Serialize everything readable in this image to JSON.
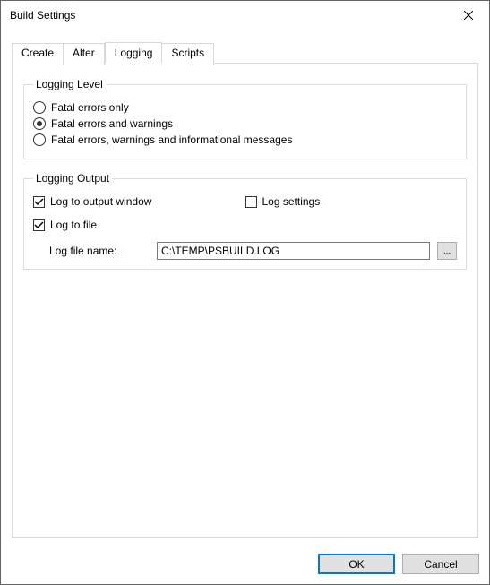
{
  "window": {
    "title": "Build Settings"
  },
  "tabs": {
    "create": "Create",
    "alter": "Alter",
    "logging": "Logging",
    "scripts": "Scripts"
  },
  "logging_level": {
    "legend": "Logging Level",
    "opt1": "Fatal errors only",
    "opt2": "Fatal errors and warnings",
    "opt3": "Fatal errors, warnings and informational messages"
  },
  "logging_output": {
    "legend": "Logging Output",
    "log_to_output": "Log to output window",
    "log_settings": "Log settings",
    "log_to_file": "Log to file",
    "log_file_label": "Log file name:",
    "log_file_value": "C:\\TEMP\\PSBUILD.LOG",
    "browse": "..."
  },
  "buttons": {
    "ok": "OK",
    "cancel": "Cancel"
  }
}
